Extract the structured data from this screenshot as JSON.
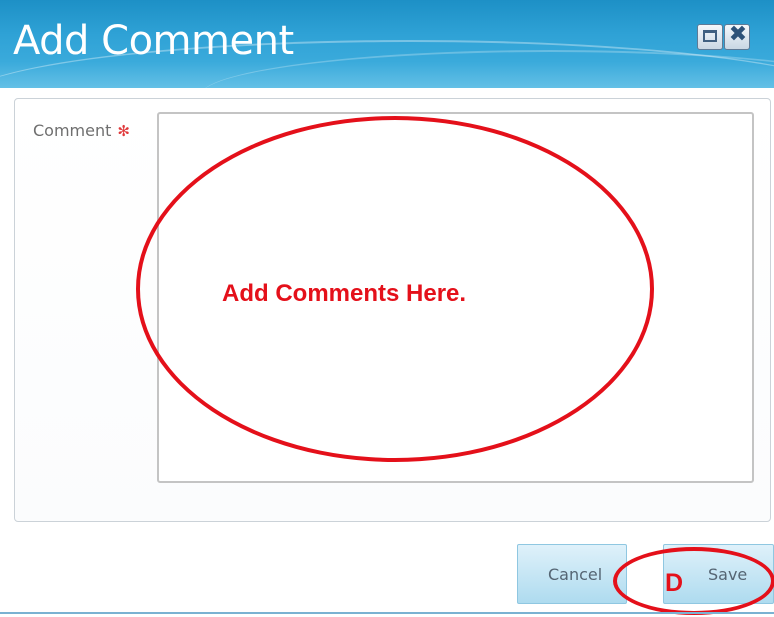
{
  "dialog": {
    "title": "Add Comment",
    "window_buttons": {
      "maximize_icon": "maximize-icon",
      "close_icon": "close-icon",
      "close_glyph": "✖"
    }
  },
  "form": {
    "comment_label": "Comment",
    "required_marker": "✻",
    "comment_value": ""
  },
  "buttons": {
    "cancel_label": "Cancel",
    "save_label": "Save"
  },
  "annotations": {
    "textarea_note": "Add Comments Here.",
    "save_marker": "D",
    "color": "#e4101a"
  },
  "colors": {
    "titlebar": "#2fa2d6",
    "button_fill": "#aedbef",
    "required": "#e0393b"
  }
}
